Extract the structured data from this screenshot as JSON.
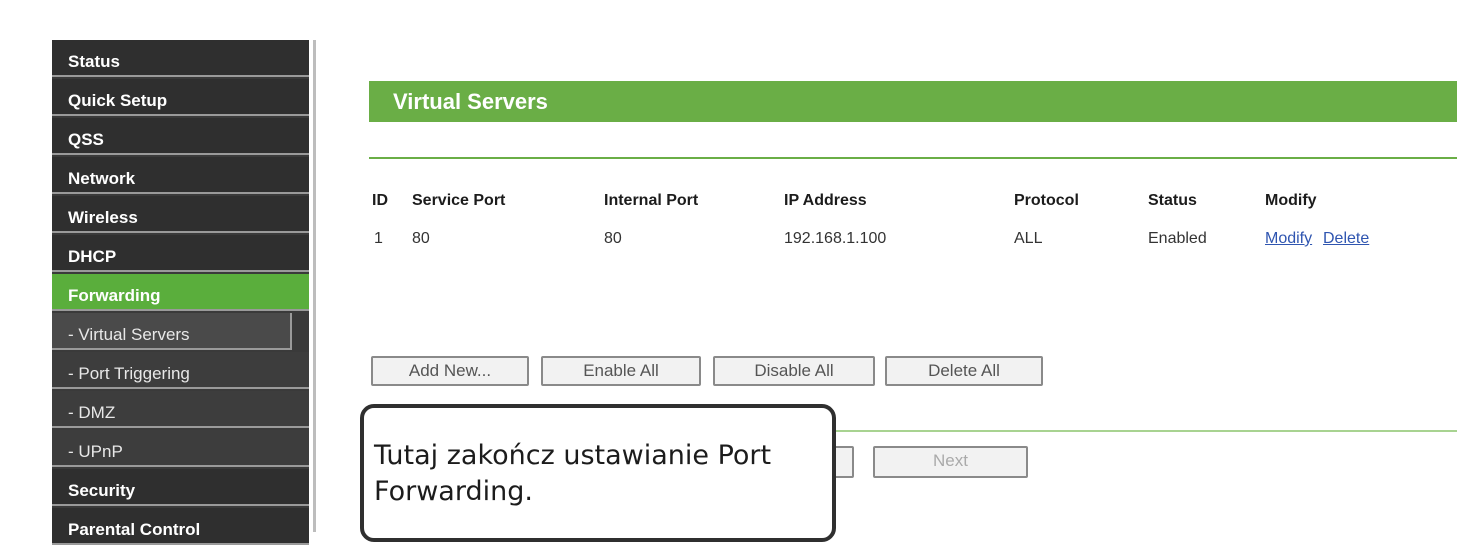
{
  "sidebar": {
    "items": [
      {
        "label": "Status"
      },
      {
        "label": "Quick Setup"
      },
      {
        "label": "QSS"
      },
      {
        "label": "Network"
      },
      {
        "label": "Wireless"
      },
      {
        "label": "DHCP"
      },
      {
        "label": "Forwarding"
      },
      {
        "label": "- Virtual Servers"
      },
      {
        "label": "- Port Triggering"
      },
      {
        "label": "- DMZ"
      },
      {
        "label": "- UPnP"
      },
      {
        "label": "Security"
      },
      {
        "label": "Parental Control"
      }
    ]
  },
  "main": {
    "title": "Virtual Servers",
    "table": {
      "headers": [
        "ID",
        "Service Port",
        "Internal Port",
        "IP Address",
        "Protocol",
        "Status",
        "Modify"
      ],
      "rows": [
        {
          "id": "1",
          "service_port": "80",
          "internal_port": "80",
          "ip_address": "192.168.1.100",
          "protocol": "ALL",
          "status": "Enabled",
          "modify": "Modify",
          "delete": "Delete"
        }
      ]
    },
    "buttons": {
      "add_new": "Add New...",
      "enable_all": "Enable All",
      "disable_all": "Disable All",
      "delete_all": "Delete All",
      "next": "Next"
    }
  },
  "callout": {
    "line1": "Tutaj zakończ ustawianie Port",
    "line2": "Forwarding."
  }
}
